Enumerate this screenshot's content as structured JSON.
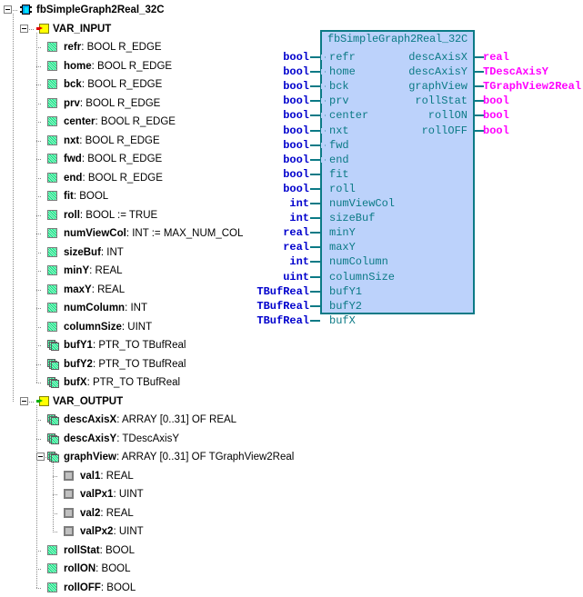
{
  "tree": {
    "root": {
      "label": "fbSimpleGraph2Real_32C",
      "icon": "function-block-icon",
      "expanded": true
    },
    "sections": [
      {
        "label": "VAR_INPUT",
        "icon": "var-input-icon",
        "expanded": true,
        "vars": [
          {
            "name": "refr",
            "sep": " : ",
            "type": "BOOL R_EDGE",
            "icon": "scalar-var-icon"
          },
          {
            "name": "home",
            "sep": " : ",
            "type": "BOOL R_EDGE",
            "icon": "scalar-var-icon"
          },
          {
            "name": "bck",
            "sep": " : ",
            "type": "BOOL R_EDGE",
            "icon": "scalar-var-icon"
          },
          {
            "name": "prv",
            "sep": " : ",
            "type": "BOOL R_EDGE",
            "icon": "scalar-var-icon"
          },
          {
            "name": "center",
            "sep": " : ",
            "type": "BOOL R_EDGE",
            "icon": "scalar-var-icon"
          },
          {
            "name": "nxt",
            "sep": " : ",
            "type": "BOOL R_EDGE",
            "icon": "scalar-var-icon"
          },
          {
            "name": "fwd",
            "sep": " : ",
            "type": "BOOL R_EDGE",
            "icon": "scalar-var-icon"
          },
          {
            "name": "end",
            "sep": " : ",
            "type": "BOOL R_EDGE",
            "icon": "scalar-var-icon"
          },
          {
            "name": "fit",
            "sep": " : ",
            "type": "BOOL",
            "icon": "scalar-var-icon"
          },
          {
            "name": "roll",
            "sep": " : ",
            "type": "BOOL := TRUE",
            "icon": "scalar-var-icon"
          },
          {
            "name": "numViewCol",
            "sep": " : ",
            "type": "INT := MAX_NUM_COL",
            "icon": "scalar-var-icon"
          },
          {
            "name": "sizeBuf",
            "sep": " : ",
            "type": "INT",
            "icon": "scalar-var-icon"
          },
          {
            "name": "minY",
            "sep": " : ",
            "type": "REAL",
            "icon": "scalar-var-icon"
          },
          {
            "name": "maxY",
            "sep": " : ",
            "type": "REAL",
            "icon": "scalar-var-icon"
          },
          {
            "name": "numColumn",
            "sep": " : ",
            "type": "INT",
            "icon": "scalar-var-icon"
          },
          {
            "name": "columnSize",
            "sep": " : ",
            "type": "UINT",
            "icon": "scalar-var-icon"
          },
          {
            "name": "bufY1",
            "sep": " : ",
            "type": "PTR_TO TBufReal",
            "icon": "complex-var-icon"
          },
          {
            "name": "bufY2",
            "sep": " : ",
            "type": "PTR_TO TBufReal",
            "icon": "complex-var-icon"
          },
          {
            "name": "bufX",
            "sep": " : ",
            "type": "PTR_TO TBufReal",
            "icon": "complex-var-icon"
          }
        ]
      },
      {
        "label": "VAR_OUTPUT",
        "icon": "var-output-icon",
        "expanded": true,
        "vars": [
          {
            "name": "descAxisX",
            "sep": " : ",
            "type": "ARRAY [0..31] OF REAL",
            "icon": "complex-var-icon"
          },
          {
            "name": "descAxisY",
            "sep": " : ",
            "type": "TDescAxisY",
            "icon": "complex-var-icon"
          },
          {
            "name": "graphView",
            "sep": " : ",
            "type": "ARRAY [0..31] OF TGraphView2Real",
            "icon": "complex-var-icon",
            "expanded": true,
            "members": [
              {
                "name": "val1",
                "sep": " : ",
                "type": "REAL",
                "icon": "struct-member-icon"
              },
              {
                "name": "valPx1",
                "sep": " : ",
                "type": "UINT",
                "icon": "struct-member-icon"
              },
              {
                "name": "val2",
                "sep": " : ",
                "type": "REAL",
                "icon": "struct-member-icon"
              },
              {
                "name": "valPx2",
                "sep": " : ",
                "type": "UINT",
                "icon": "struct-member-icon"
              }
            ]
          },
          {
            "name": "rollStat",
            "sep": " : ",
            "type": "BOOL",
            "icon": "scalar-var-icon"
          },
          {
            "name": "rollON",
            "sep": " : ",
            "type": "BOOL",
            "icon": "scalar-var-icon"
          },
          {
            "name": "rollOFF",
            "sep": " : ",
            "type": "BOOL",
            "icon": "scalar-var-icon"
          }
        ]
      }
    ]
  },
  "fb": {
    "title": "fbSimpleGraph2Real_32C",
    "colors": {
      "fill": "#bcd2fb",
      "border": "#0b7a86",
      "port_text": "#0b7a86",
      "input_type": "#0000cd",
      "output_type": "#ff00ff"
    },
    "inputs": [
      {
        "type": "bool",
        "name": "refr",
        "edge": true
      },
      {
        "type": "bool",
        "name": "home",
        "edge": true
      },
      {
        "type": "bool",
        "name": "bck",
        "edge": true
      },
      {
        "type": "bool",
        "name": "prv",
        "edge": true
      },
      {
        "type": "bool",
        "name": "center",
        "edge": true
      },
      {
        "type": "bool",
        "name": "nxt",
        "edge": true
      },
      {
        "type": "bool",
        "name": "fwd",
        "edge": true
      },
      {
        "type": "bool",
        "name": "end",
        "edge": true
      },
      {
        "type": "bool",
        "name": "fit",
        "edge": false
      },
      {
        "type": "bool",
        "name": "roll",
        "edge": false
      },
      {
        "type": "int",
        "name": "numViewCol",
        "edge": false
      },
      {
        "type": "int",
        "name": "sizeBuf",
        "edge": false
      },
      {
        "type": "real",
        "name": "minY",
        "edge": false
      },
      {
        "type": "real",
        "name": "maxY",
        "edge": false
      },
      {
        "type": "int",
        "name": "numColumn",
        "edge": false
      },
      {
        "type": "uint",
        "name": "columnSize",
        "edge": false
      },
      {
        "type": "TBufReal",
        "name": "bufY1",
        "edge": false
      },
      {
        "type": "TBufReal",
        "name": "bufY2",
        "edge": false
      },
      {
        "type": "TBufReal",
        "name": "bufX",
        "edge": false
      }
    ],
    "outputs": [
      {
        "name": "descAxisX",
        "type": "real"
      },
      {
        "name": "descAxisY",
        "type": "TDescAxisY"
      },
      {
        "name": "graphView",
        "type": "TGraphView2Real"
      },
      {
        "name": "rollStat",
        "type": "bool"
      },
      {
        "name": "rollON",
        "type": "bool"
      },
      {
        "name": "rollOFF",
        "type": "bool"
      }
    ]
  }
}
